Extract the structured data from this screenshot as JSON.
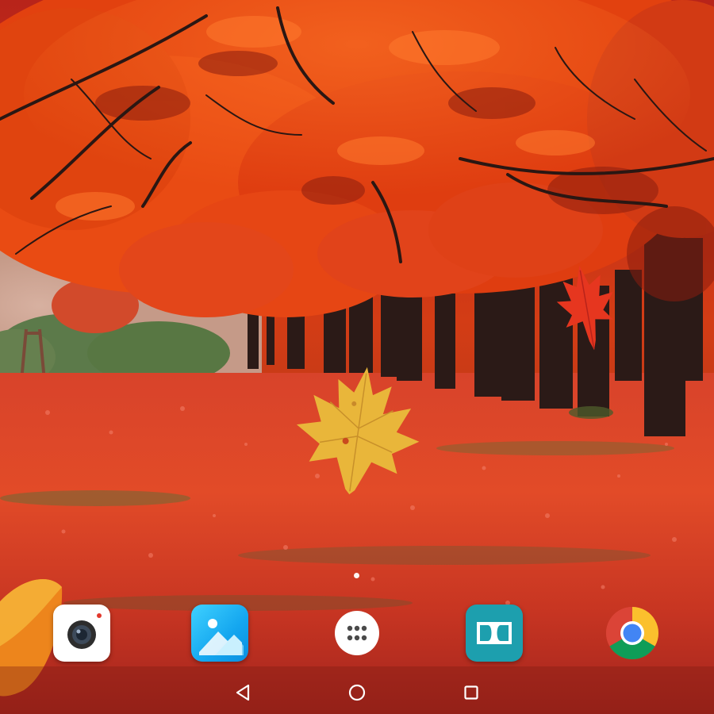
{
  "screen": {
    "wallpaper_icon": "autumn-forest-wallpaper"
  },
  "home_indicator": {
    "pages": 1,
    "current_page": 1
  },
  "dock": {
    "apps": [
      {
        "id": "camera",
        "icon": "camera-icon",
        "color": "#ffffff"
      },
      {
        "id": "gallery",
        "icon": "gallery-icon",
        "color": "#1aa9ef"
      },
      {
        "id": "app-drawer",
        "icon": "app-drawer-icon",
        "color": "#ffffff"
      },
      {
        "id": "dolby",
        "icon": "dolby-icon",
        "color": "#1d9fae"
      },
      {
        "id": "chrome",
        "icon": "chrome-icon",
        "color": "#4285f4"
      }
    ]
  },
  "navigation_bar": {
    "buttons": [
      {
        "id": "back",
        "icon": "back-triangle-icon"
      },
      {
        "id": "home",
        "icon": "home-circle-icon"
      },
      {
        "id": "recents",
        "icon": "recents-square-icon"
      }
    ]
  },
  "colors": {
    "foliage": "#e2410f",
    "ground": "#d2391c",
    "yellow_leaf": "#e9b63a",
    "nav_icon": "#ffffff"
  }
}
